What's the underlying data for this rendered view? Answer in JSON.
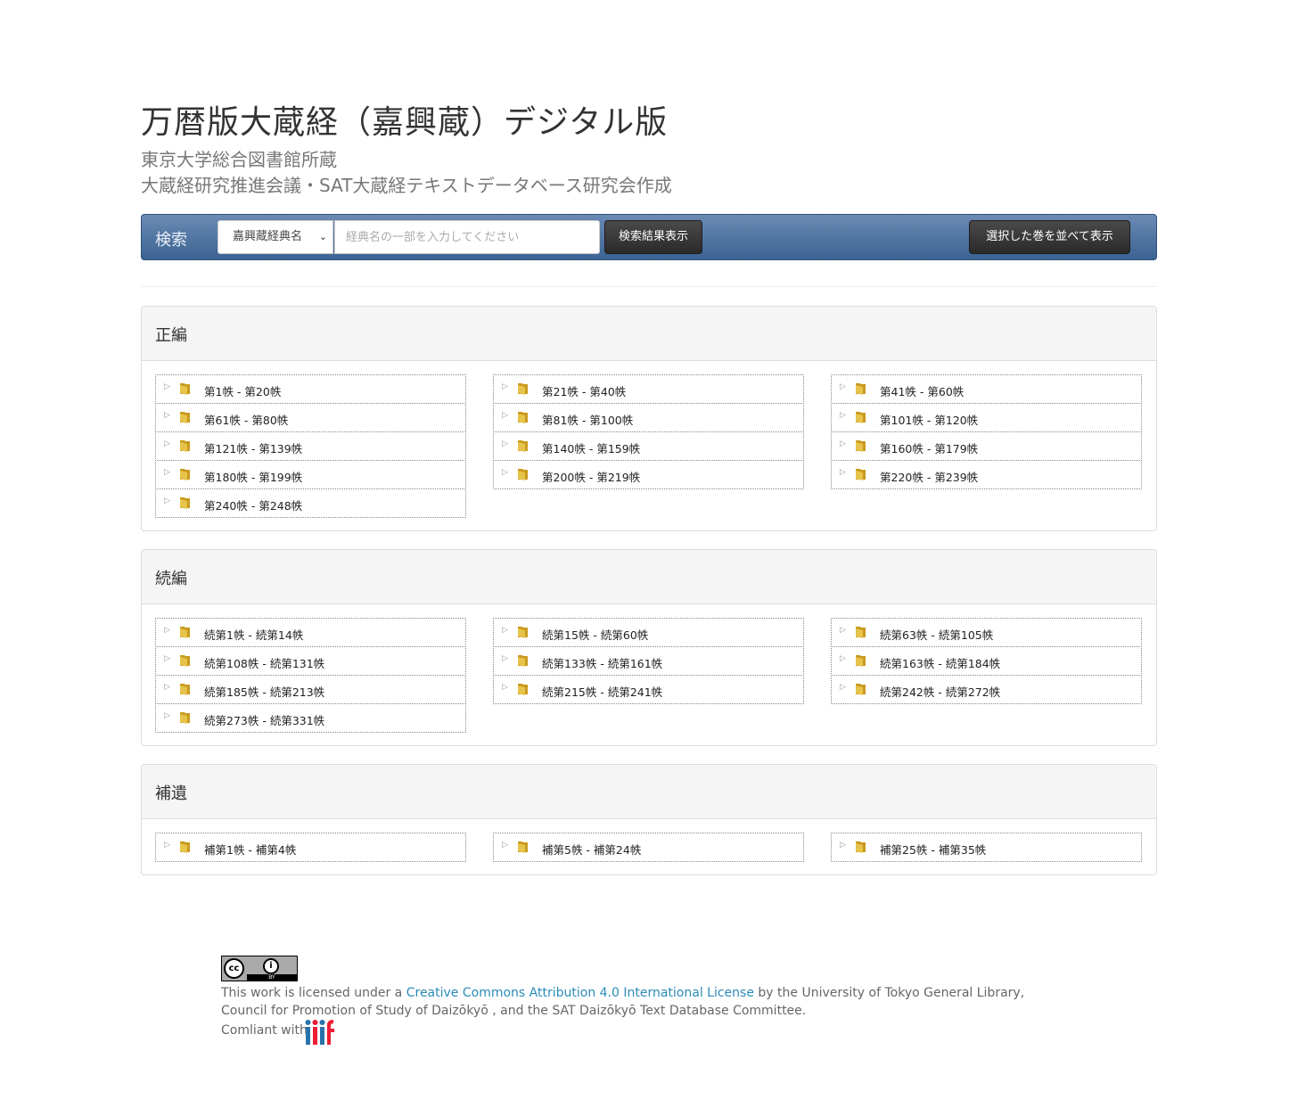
{
  "header": {
    "title": "万暦版大蔵経（嘉興蔵）デジタル版",
    "subtitle1": "東京大学総合図書館所蔵",
    "subtitle2": "大蔵経研究推進会議・SAT大蔵経テキストデータベース研究会作成"
  },
  "navbar": {
    "label": "検索",
    "select_value": "嘉興蔵経典名",
    "input_placeholder": "経典名の一部を入力してください",
    "search_button": "検索結果表示",
    "compare_button": "選択した巻を並べて表示"
  },
  "panels": [
    {
      "title": "正編",
      "columns": [
        [
          "第1帙 -  第20帙",
          "第61帙 -  第80帙",
          "第121帙 -  第139帙",
          "第180帙 -  第199帙",
          "第240帙 -  第248帙"
        ],
        [
          "第21帙 -  第40帙",
          "第81帙 -  第100帙",
          "第140帙 -  第159帙",
          "第200帙 -  第219帙"
        ],
        [
          "第41帙 -  第60帙",
          "第101帙 -  第120帙",
          "第160帙 -  第179帙",
          "第220帙 -  第239帙"
        ]
      ]
    },
    {
      "title": "続編",
      "columns": [
        [
          "続第1帙 -  続第14帙",
          "続第108帙 -  続第131帙",
          "続第185帙 -  続第213帙",
          "続第273帙 -  続第331帙"
        ],
        [
          "続第15帙 -  続第60帙",
          "続第133帙 -  続第161帙",
          "続第215帙 -  続第241帙"
        ],
        [
          "続第63帙 -  続第105帙",
          "続第163帙 -  続第184帙",
          "続第242帙 -  続第272帙"
        ]
      ]
    },
    {
      "title": "補遺",
      "columns": [
        [
          "補第1帙 -  補第4帙"
        ],
        [
          "補第5帙 -  補第24帙"
        ],
        [
          "補第25帙 -  補第35帙"
        ]
      ]
    }
  ],
  "footer": {
    "cc_badge": {
      "symbols": [
        "cc",
        "i"
      ],
      "by": "BY"
    },
    "license_prefix": "This work is licensed under a ",
    "license_link": "Creative Commons Attribution 4.0 International License",
    "license_suffix": " by the University of Tokyo General Library, Council for Promotion of Study of Daizōkyō , and the SAT Daizōkyō Text Database Committee.",
    "compliant": "Comliant with",
    "iiif_logo": "iiif"
  },
  "colors": {
    "navbar_top": "#6b8bb4",
    "navbar_bottom": "#3b6393",
    "link": "#2a8ab8",
    "folder": "#e6c34a"
  }
}
